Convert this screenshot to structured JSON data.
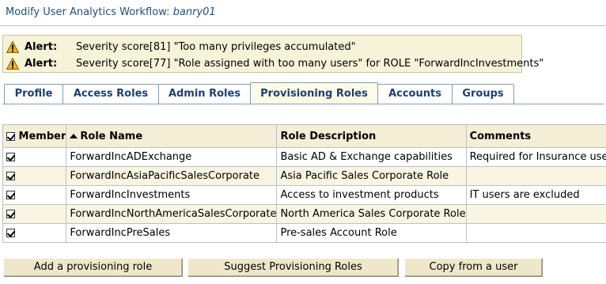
{
  "page": {
    "title_prefix": "Modify User Analytics Workflow:",
    "user_name": "banry01"
  },
  "alerts": [
    {
      "label": "Alert:",
      "text": "Severity score[81] \"Too many privileges accumulated\"",
      "icon": "warning-icon"
    },
    {
      "label": "Alert:",
      "text": "Severity score[77] \"Role assigned with too many users\" for ROLE \"ForwardIncInvestments\"",
      "icon": "warning-icon"
    }
  ],
  "tabs": [
    {
      "label": "Profile",
      "active": false
    },
    {
      "label": "Access Roles",
      "active": false
    },
    {
      "label": "Admin Roles",
      "active": false
    },
    {
      "label": "Provisioning Roles",
      "active": true
    },
    {
      "label": "Accounts",
      "active": false
    },
    {
      "label": "Groups",
      "active": false
    }
  ],
  "table": {
    "headers": {
      "member": "Member",
      "role_name": "Role Name",
      "role_description": "Role Description",
      "comments": "Comments"
    },
    "header_checkbox_checked": true,
    "sort_column": "role_name",
    "rows": [
      {
        "checked": true,
        "role_name": "ForwardIncADExchange",
        "role_description": "Basic AD & Exchange capabilities",
        "comments": "Required for Insurance users"
      },
      {
        "checked": true,
        "role_name": "ForwardIncAsiaPacificSalesCorporate",
        "role_description": "Asia Pacific Sales Corporate Role",
        "comments": ""
      },
      {
        "checked": true,
        "role_name": "ForwardIncInvestments",
        "role_description": "Access to investment products",
        "comments": "IT users are excluded"
      },
      {
        "checked": true,
        "role_name": "ForwardIncNorthAmericaSalesCorporate",
        "role_description": "North America Sales Corporate Role",
        "comments": ""
      },
      {
        "checked": true,
        "role_name": "ForwardIncPreSales",
        "role_description": "Pre-sales Account Role",
        "comments": ""
      }
    ]
  },
  "buttons": {
    "add": "Add a provisioning role",
    "suggest": "Suggest Provisioning Roles",
    "copy": "Copy from a user"
  },
  "colors": {
    "title": "#1f4e79",
    "alert_background": "#f6f3d8",
    "header_background": "#f4eed6",
    "button_background": "#efe7c9"
  }
}
